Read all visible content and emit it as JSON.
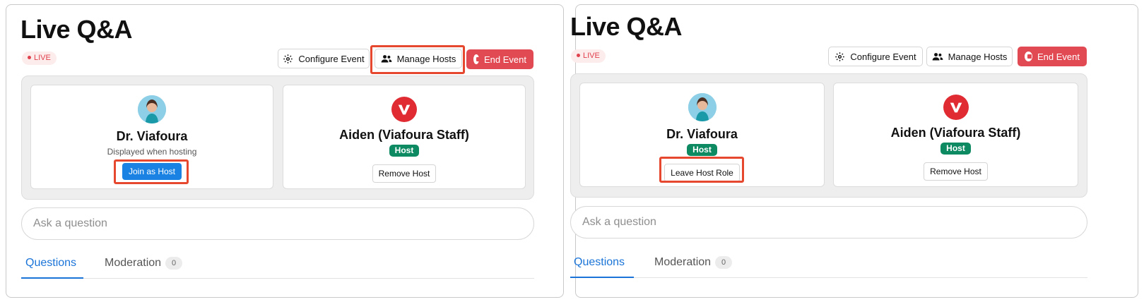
{
  "panels": [
    {
      "title": "Live Q&A",
      "live_label": "LIVE",
      "toolbar": {
        "configure_label": "Configure Event",
        "manage_label": "Manage Hosts",
        "end_label": "End Event"
      },
      "hosts": [
        {
          "name": "Dr. Viafoura",
          "subtitle": "Displayed when hosting",
          "action_label": "Join as Host"
        },
        {
          "name": "Aiden (Viafoura Staff)",
          "badge": "Host",
          "action_label": "Remove Host"
        }
      ],
      "ask_placeholder": "Ask a question",
      "tabs": [
        {
          "label": "Questions"
        },
        {
          "label": "Moderation",
          "count": "0"
        }
      ]
    },
    {
      "title": "Live Q&A",
      "live_label": "LIVE",
      "toolbar": {
        "configure_label": "Configure Event",
        "manage_label": "Manage Hosts",
        "end_label": "End Event"
      },
      "hosts": [
        {
          "name": "Dr. Viafoura",
          "badge": "Host",
          "action_label": "Leave Host Role"
        },
        {
          "name": "Aiden (Viafoura Staff)",
          "badge": "Host",
          "action_label": "Remove Host"
        }
      ],
      "ask_placeholder": "Ask a question",
      "tabs": [
        {
          "label": "Questions"
        },
        {
          "label": "Moderation",
          "count": "0"
        }
      ]
    }
  ],
  "colors": {
    "accent": "#1a74d8",
    "live": "#e0424d",
    "end_button": "#e24a53",
    "host_chip": "#0e8a63",
    "highlight": "#e5482f"
  },
  "icons": {
    "configure": "gear-icon",
    "manage": "users-icon",
    "end": "stop-circle-icon",
    "brand": "viafoura-logo"
  }
}
